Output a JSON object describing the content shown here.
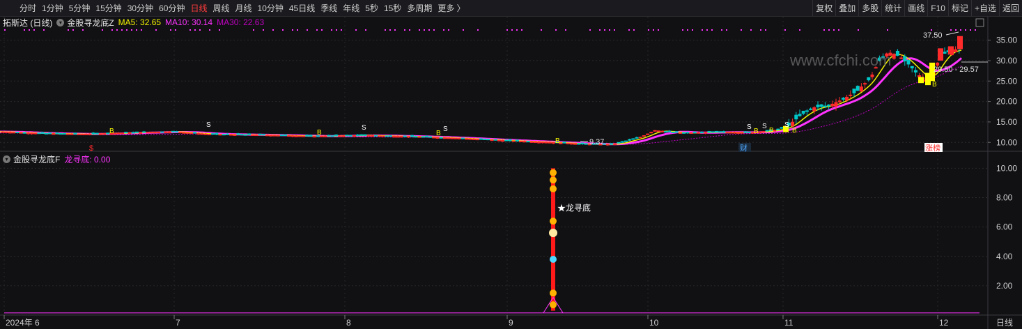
{
  "toolbar": {
    "periods": [
      "分时",
      "1分钟",
      "5分钟",
      "15分钟",
      "30分钟",
      "60分钟",
      "日线",
      "周线",
      "月线",
      "10分钟",
      "45日线",
      "季线",
      "年线",
      "5秒",
      "15秒",
      "多周期",
      "更多 〉"
    ],
    "active_period": "日线",
    "tools": [
      "复权",
      "叠加",
      "多股",
      "统计",
      "画线",
      "F10",
      "标记",
      "+自选",
      "返回"
    ]
  },
  "main_panel": {
    "stock": "拓斯达 (日线)",
    "indicator": "金股寻龙底Z",
    "ma5_label": "MA5: 32.65",
    "ma10_label": "MA10: 30.14",
    "ma30_label": "MA30: 22.63",
    "high_label": "37.50",
    "low_label": "9.37",
    "range_label": "29.50 - 29.57",
    "cai_label": "财",
    "zhangbang_label": "涨榜",
    "dollar_label": "$",
    "y_ticks": [
      "35.00",
      "30.00",
      "25.00",
      "20.00",
      "15.00",
      "10.00"
    ],
    "colors": {
      "ma5": "#f2f200",
      "ma10": "#ff33ff",
      "ma30": "#c000c0",
      "up": "#ff2b2b",
      "down": "#00c8c8"
    }
  },
  "sub_panel": {
    "indicator": "金股寻龙底F",
    "value_label": "龙寻底: 0.00",
    "signal_label": "★龙寻底",
    "y_ticks": [
      "10.00",
      "8.00",
      "6.00",
      "4.00",
      "2.00"
    ]
  },
  "x_axis": {
    "labels": [
      "2024年 6",
      "7",
      "8",
      "9",
      "10",
      "11",
      "12"
    ],
    "corner": "日线"
  },
  "watermark": "www.cfchi.com",
  "chart_data": {
    "type": "candlestick",
    "title": "拓斯达 (日线)",
    "x": [
      "2024-06",
      "2024-07",
      "2024-08",
      "2024-09",
      "2024-10",
      "2024-11",
      "2024-12"
    ],
    "close_approx": [
      12.3,
      12.0,
      11.5,
      10.2,
      12.0,
      13.5,
      32.65
    ],
    "series": [
      {
        "name": "MA5",
        "last": 32.65
      },
      {
        "name": "MA10",
        "last": 30.14
      },
      {
        "name": "MA30",
        "last": 22.63
      }
    ],
    "ylim": [
      8,
      38
    ],
    "annotations": [
      "37.50",
      "9.37",
      "29.50 - 29.57"
    ]
  }
}
